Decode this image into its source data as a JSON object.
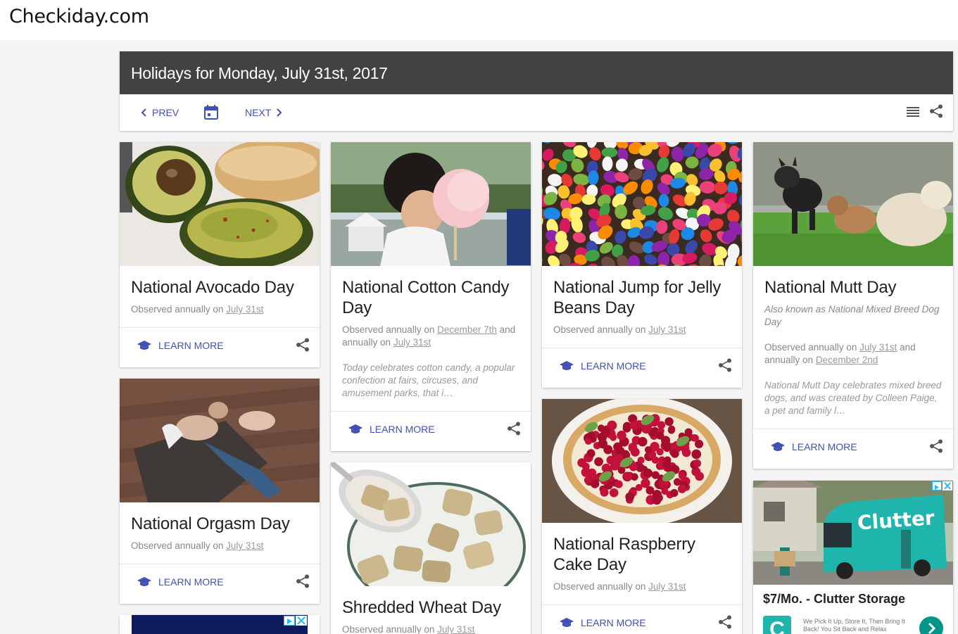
{
  "site": {
    "logo": "Checkiday.com"
  },
  "header": {
    "title": "Holidays for Monday, July 31st, 2017",
    "prev_label": "PREV",
    "next_label": "NEXT"
  },
  "actions": {
    "learn_more": "LEARN MORE"
  },
  "cards": {
    "avocado": {
      "title": "National Avocado Day",
      "obs_prefix": "Observed annually on ",
      "date1": "July 31st"
    },
    "orgasm": {
      "title": "National Orgasm Day",
      "obs_prefix": "Observed annually on ",
      "date1": "July 31st"
    },
    "cotton": {
      "title": "National Cotton Candy Day",
      "obs_prefix": "Observed annually on ",
      "date1": "December 7th",
      "obs_mid": " and annually on ",
      "date2": "July 31st",
      "excerpt": "Today celebrates cotton candy, a popular confection at fairs, circuses, and amusement parks, that i…"
    },
    "wheat": {
      "title": "Shredded Wheat Day",
      "obs_prefix": "Observed annually on ",
      "date1": "July 31st"
    },
    "jelly": {
      "title": "National Jump for Jelly Beans Day",
      "obs_prefix": "Observed annually on ",
      "date1": "July 31st"
    },
    "raspberry": {
      "title": "National Raspberry Cake Day",
      "obs_prefix": "Observed annually on ",
      "date1": "July 31st"
    },
    "mutt": {
      "title": "National Mutt Day",
      "aka": "Also known as National Mixed Breed Dog Day",
      "obs_prefix": "Observed annually on ",
      "date1": "July 31st",
      "obs_mid": " and annually on ",
      "date2": "December 2nd",
      "excerpt": "National Mutt Day celebrates mixed breed dogs, and was created by Colleen Paige, a pet and family l…"
    }
  },
  "ad": {
    "truck_text": "Clutter",
    "headline": "$7/Mo. - Clutter Storage",
    "tagline": "We Pick It Up, Store It, Then Bring It Back! You Sit Back and Relax",
    "logo_letter": "C"
  },
  "colors": {
    "accent": "#3f51b5",
    "header_dark": "#424242",
    "clutter_teal": "#1fb5ad"
  }
}
